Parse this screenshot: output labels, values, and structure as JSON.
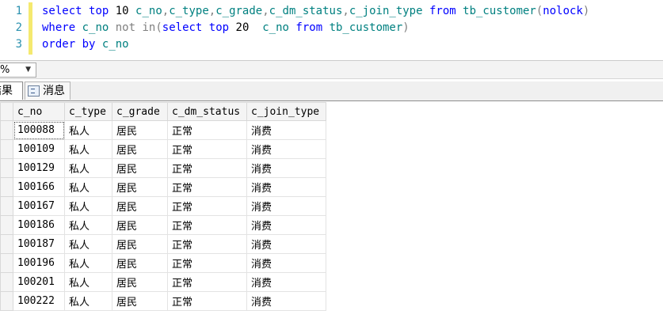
{
  "editor": {
    "line_numbers": [
      "1",
      "2",
      "3"
    ],
    "line1": {
      "select": "select",
      "top": "top",
      "num": "10",
      "cols": "c_no",
      "c1": ",",
      "col2": "c_type",
      "c2": ",",
      "col3": "c_grade",
      "c3": ",",
      "col4": "c_dm_status",
      "c4": ",",
      "col5": "c_join_type",
      "from": "from",
      "table": "tb_customer",
      "lp": "(",
      "hint": "nolock",
      "rp": ")"
    },
    "line2": {
      "where": "where",
      "col": "c_no",
      "not": "not",
      "in": "in",
      "lp": "(",
      "select": "select",
      "top": "top",
      "num": "20",
      "col2": "c_no",
      "from": "from",
      "table": "tb_customer",
      "rp": ")"
    },
    "line3": {
      "order": "order",
      "by": "by",
      "col": "c_no"
    }
  },
  "zoom": {
    "value": "%",
    "arrow": "▼"
  },
  "tabs": {
    "results": "结果",
    "messages": "消息"
  },
  "grid": {
    "columns": [
      "c_no",
      "c_type",
      "c_grade",
      "c_dm_status",
      "c_join_type"
    ],
    "rows": [
      [
        "100088",
        "私人",
        "居民",
        "正常",
        "消费"
      ],
      [
        "100109",
        "私人",
        "居民",
        "正常",
        "消费"
      ],
      [
        "100129",
        "私人",
        "居民",
        "正常",
        "消费"
      ],
      [
        "100166",
        "私人",
        "居民",
        "正常",
        "消费"
      ],
      [
        "100167",
        "私人",
        "居民",
        "正常",
        "消费"
      ],
      [
        "100186",
        "私人",
        "居民",
        "正常",
        "消费"
      ],
      [
        "100187",
        "私人",
        "居民",
        "正常",
        "消费"
      ],
      [
        "100196",
        "私人",
        "居民",
        "正常",
        "消费"
      ],
      [
        "100201",
        "私人",
        "居民",
        "正常",
        "消费"
      ],
      [
        "100222",
        "私人",
        "居民",
        "正常",
        "消费"
      ]
    ]
  }
}
